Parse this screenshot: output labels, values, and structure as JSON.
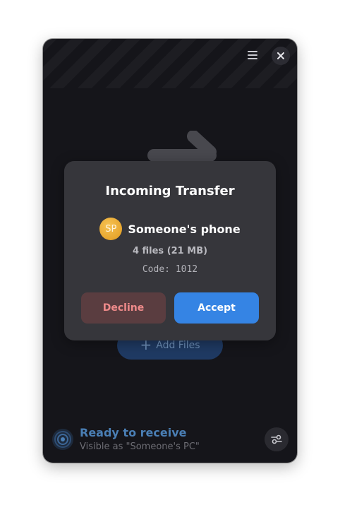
{
  "colors": {
    "accent": "#3584e4",
    "destructive": "#ef8a8a",
    "window_bg": "#15151a",
    "dialog_bg": "#36363b",
    "avatar": "#f0b23a"
  },
  "header": {
    "menu_icon": "hamburger-menu-icon",
    "close_icon": "close-icon"
  },
  "main": {
    "add_files_label": "Add Files",
    "add_files_icon": "plus-icon"
  },
  "status": {
    "title": "Ready to receive",
    "subtitle": "Visible as \"Someone's PC\"",
    "icon": "radar-icon"
  },
  "footer": {
    "prefs_icon": "preferences-icon"
  },
  "dialog": {
    "title": "Incoming Transfer",
    "sender": {
      "initials": "SP",
      "name": "Someone's phone"
    },
    "files_info": "4 files (21 MB)",
    "code": "Code: 1012",
    "decline_label": "Decline",
    "accept_label": "Accept"
  }
}
